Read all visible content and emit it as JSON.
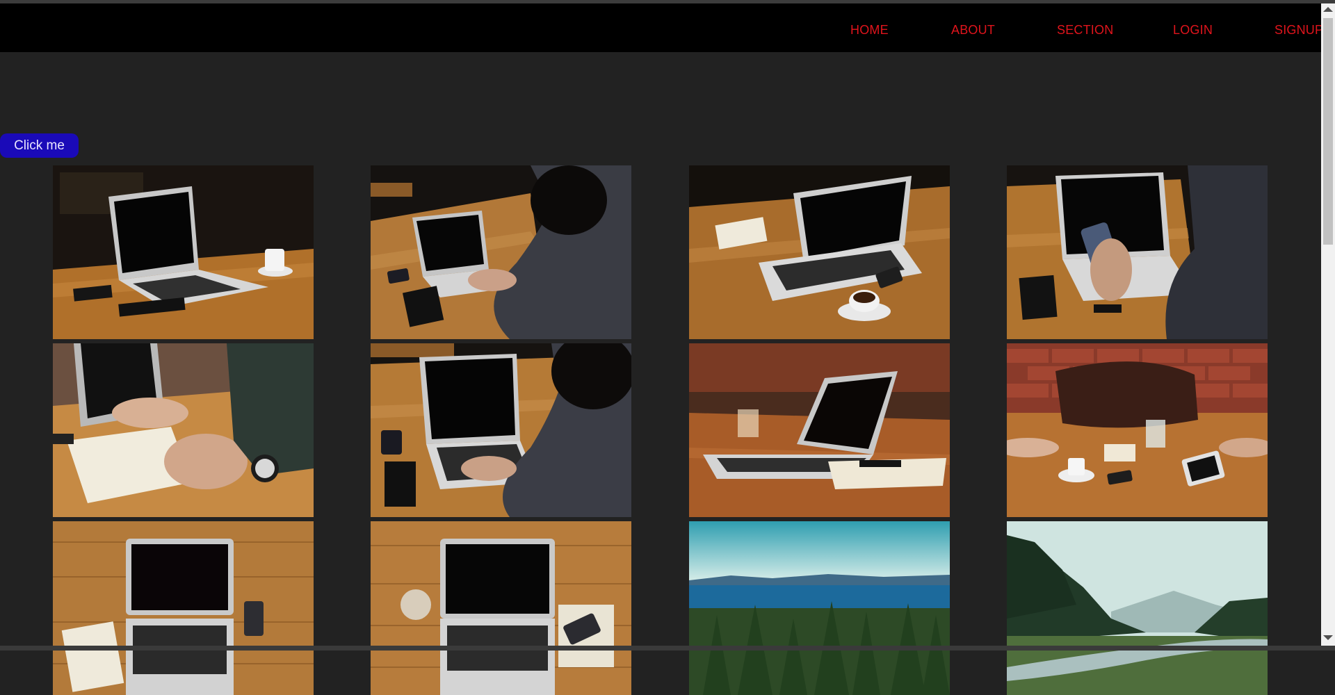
{
  "nav": {
    "home": "HOME",
    "about": "ABOUT",
    "section": "SECTION",
    "login": "LOGIN",
    "signup": "SIGNUP"
  },
  "button": {
    "label": "Click me"
  },
  "gallery": {
    "images": [
      "laptop-on-table-with-coffee-cup",
      "man-typing-on-laptop",
      "laptop-with-notebook-and-coffee",
      "man-holding-phone-at-laptop",
      "hand-writing-in-notebook",
      "man-typing-on-laptop-closeup",
      "laptop-with-glass-on-table",
      "leather-bag-with-tablet-and-coffee",
      "laptop-top-view-on-wood",
      "laptop-top-view-with-glass-and-phone",
      "lake-and-forest-landscape",
      "misty-mountain-valley"
    ]
  },
  "colors": {
    "background": "#222222",
    "navbar": "#000000",
    "nav_link": "#e0141c",
    "button": "#1a0ab8"
  }
}
